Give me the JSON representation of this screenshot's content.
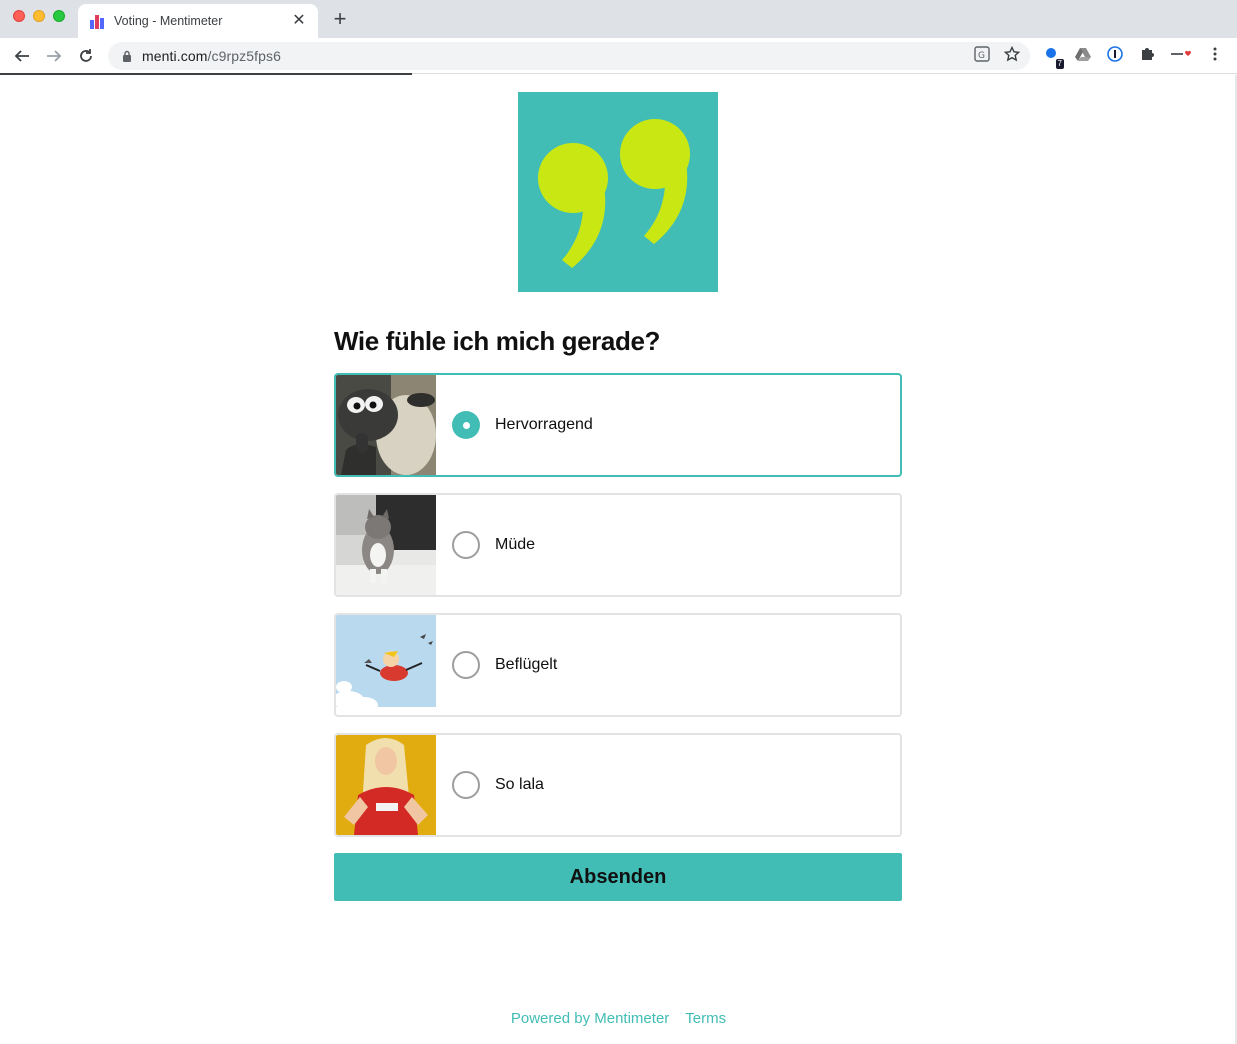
{
  "browser": {
    "tab_title": "Voting - Mentimeter",
    "url_host": "menti.com",
    "url_path": "/c9rpz5fps6",
    "extension_badge": "7"
  },
  "page": {
    "question": "Wie fühle ich mich gerade?",
    "options": [
      {
        "label": "Hervorragend",
        "selected": true
      },
      {
        "label": "Müde",
        "selected": false
      },
      {
        "label": "Beflügelt",
        "selected": false
      },
      {
        "label": "So lala",
        "selected": false
      }
    ],
    "submit_label": "Absenden",
    "accent_color": "#41bdb5",
    "quote_color": "#c9e813"
  },
  "footer": {
    "powered_by": "Powered by Mentimeter",
    "terms": "Terms"
  }
}
